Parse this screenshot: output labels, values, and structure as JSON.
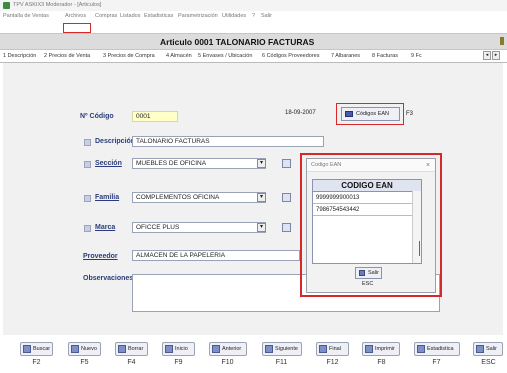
{
  "window": {
    "title": "TPV ASKIX3 Moderador - [Articulos]"
  },
  "menu": {
    "items": [
      "Pantalla de Ventas",
      "Archivos",
      "Compras",
      "Listados",
      "Estadisticas",
      "Parametrización",
      "Utilidades",
      "?",
      "Salir"
    ]
  },
  "header": {
    "title": "Articulo  0001  TALONARIO FACTURAS"
  },
  "tabs": [
    "1 Descripción",
    "2 Precios de Venta",
    "3 Precios de Compra",
    "4 Almacén",
    "5 Envases / Ubicación",
    "6 Códigos Proveedores",
    "7 Albaranes",
    "8 Facturas",
    "9 Fc"
  ],
  "form": {
    "codigo_label": "Nº Código",
    "codigo_value": "0001",
    "fecha": "18-09-2007",
    "codigos_ean_button": "Códigos EAN",
    "f_key": "F3",
    "descripcion_label": "Descripción",
    "descripcion_value": "TALONARIO FACTURAS",
    "seccion_label": "Sección",
    "seccion_value": "MUEBLES DE OFICINA",
    "familia_label": "Familia",
    "familia_value": "COMPLEMENTOS OFICINA",
    "marca_label": "Marca",
    "marca_value": "OFICCE PLUS",
    "proveedor_label": "Proveedor",
    "proveedor_value": "ALMACEN DE LA PAPELERIA",
    "observaciones_label": "Observaciones"
  },
  "ean_dialog": {
    "title": "Codigo EAN",
    "close": "×",
    "header": "CODIGO EAN",
    "rows": [
      "9999999900013",
      "7986754543442"
    ],
    "salir_label": "Salir",
    "esc": "ESC"
  },
  "toolbar": {
    "buttons": [
      {
        "label": "Buscar",
        "key": "F2"
      },
      {
        "label": "Nuevo",
        "key": "F5"
      },
      {
        "label": "Borrar",
        "key": "F4"
      },
      {
        "label": "Inicio",
        "key": "F9"
      },
      {
        "label": "Anterior",
        "key": "F10"
      },
      {
        "label": "Siguiente",
        "key": "F11"
      },
      {
        "label": "Final",
        "key": "F12"
      },
      {
        "label": "Imprimir",
        "key": "F8"
      },
      {
        "label": "Estadistica",
        "key": "F7"
      },
      {
        "label": "Salir",
        "key": "ESC"
      }
    ]
  },
  "colors": {
    "highlight_red": "#d62828",
    "title_bar": "#dcdcdc",
    "label_blue": "#2a3d7a",
    "codigo_bg": "#ffffc8"
  }
}
